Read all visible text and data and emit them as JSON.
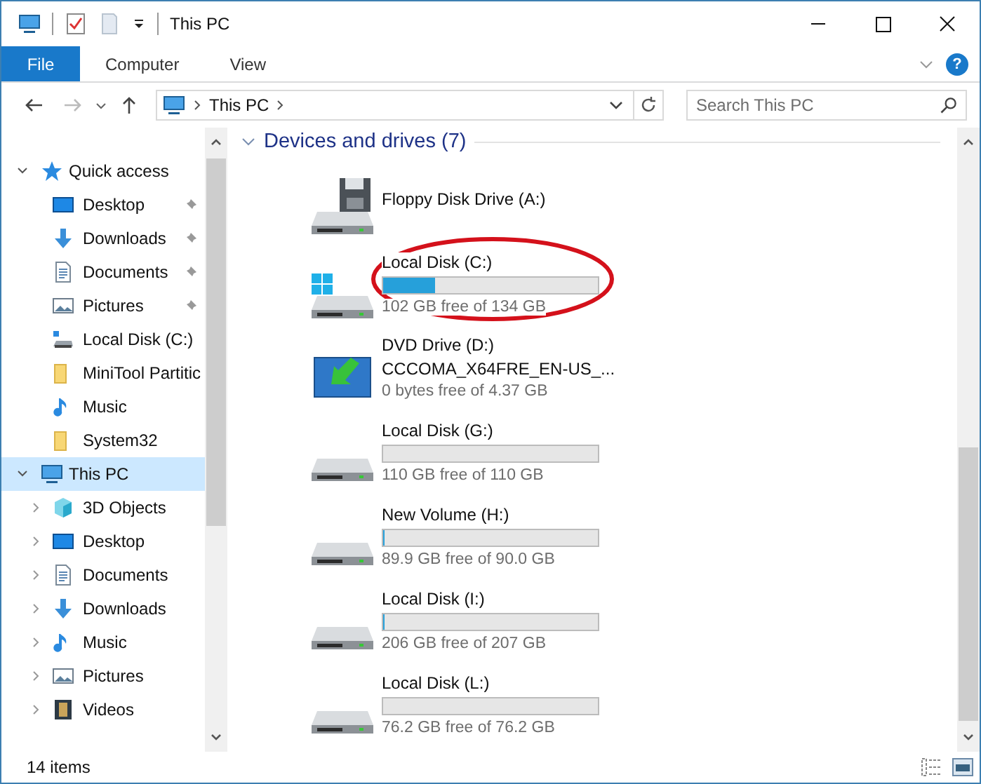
{
  "window": {
    "title": "This PC"
  },
  "ribbon": {
    "file_menu": "File",
    "tabs": [
      "Computer",
      "View"
    ],
    "help": "?"
  },
  "address": {
    "path": "This PC",
    "search": {
      "placeholder": "Search This PC"
    }
  },
  "nav": [
    {
      "label": "Quick access",
      "kind": "star",
      "expanded": true,
      "selected": false,
      "children": [
        {
          "label": "Desktop",
          "kind": "desktop",
          "pinned": true
        },
        {
          "label": "Downloads",
          "kind": "downloads",
          "pinned": true
        },
        {
          "label": "Documents",
          "kind": "documents",
          "pinned": true
        },
        {
          "label": "Pictures",
          "kind": "pictures",
          "pinned": true
        },
        {
          "label": "Local Disk (C:)",
          "kind": "drive",
          "pinned": false
        },
        {
          "label": "MiniTool Partitic",
          "kind": "folder",
          "pinned": false
        },
        {
          "label": "Music",
          "kind": "music",
          "pinned": false
        },
        {
          "label": "System32",
          "kind": "folder",
          "pinned": false
        }
      ]
    },
    {
      "label": "This PC",
      "kind": "pc",
      "expanded": true,
      "selected": true,
      "children": [
        {
          "label": "3D Objects",
          "kind": "cube",
          "expanded": false
        },
        {
          "label": "Desktop",
          "kind": "desktop",
          "expanded": false
        },
        {
          "label": "Documents",
          "kind": "documents",
          "expanded": false
        },
        {
          "label": "Downloads",
          "kind": "downloads",
          "expanded": false
        },
        {
          "label": "Music",
          "kind": "music",
          "expanded": false
        },
        {
          "label": "Pictures",
          "kind": "pictures",
          "expanded": false
        },
        {
          "label": "Videos",
          "kind": "videos",
          "expanded": false
        }
      ]
    }
  ],
  "section": {
    "title": "Devices and drives (7)",
    "expanded": true
  },
  "drives": [
    {
      "kind": "floppy",
      "name": "Floppy Disk Drive (A:)"
    },
    {
      "kind": "system",
      "name": "Local Disk (C:)",
      "level": 0.24,
      "free": "102 GB free of 134 GB",
      "circled": true
    },
    {
      "kind": "dvd",
      "name": "DVD Drive (D:)",
      "label": "CCCOMA_X64FRE_EN-US_...",
      "free": "0 bytes free of 4.37 GB"
    },
    {
      "kind": "hdd",
      "name": "Local Disk (G:)",
      "free": "110 GB free of 110 GB"
    },
    {
      "kind": "hdd",
      "name": "New Volume (H:)",
      "level": 0.002,
      "free": "89.9 GB free of 90.0 GB"
    },
    {
      "kind": "hdd",
      "name": "Local Disk (I:)",
      "level": 0.005,
      "free": "206 GB free of 207 GB"
    },
    {
      "kind": "hdd",
      "name": "Local Disk (L:)",
      "free": "76.2 GB free of 76.2 GB"
    }
  ],
  "status_bar": {
    "count": "14 items"
  }
}
